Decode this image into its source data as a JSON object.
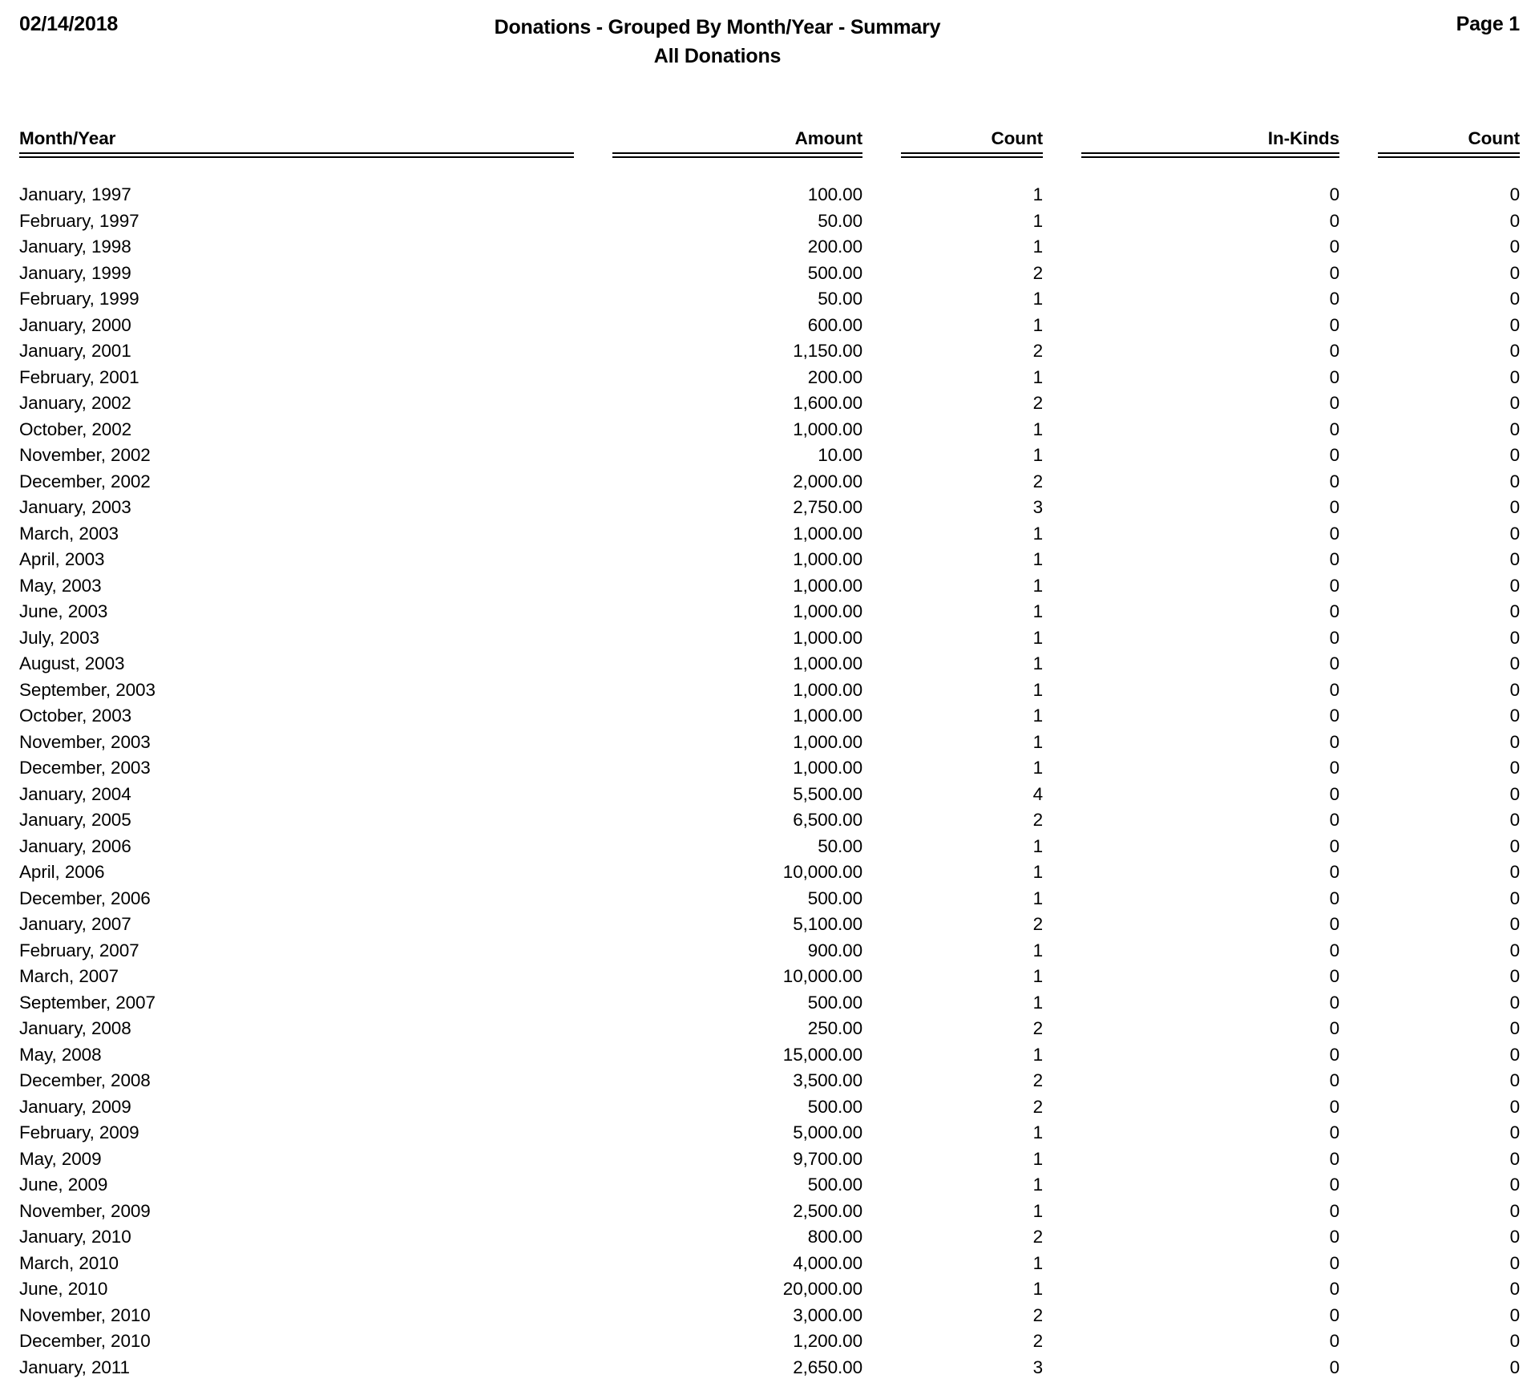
{
  "header": {
    "date": "02/14/2018",
    "title": "Donations - Grouped By Month/Year - Summary",
    "subtitle": "All Donations",
    "page_label": "Page 1"
  },
  "table": {
    "columns": [
      {
        "key": "month_year",
        "label": "Month/Year",
        "align": "left"
      },
      {
        "key": "amount",
        "label": "Amount",
        "align": "right"
      },
      {
        "key": "count",
        "label": "Count",
        "align": "right"
      },
      {
        "key": "in_kinds",
        "label": "In-Kinds",
        "align": "right"
      },
      {
        "key": "in_kinds_count",
        "label": "Count",
        "align": "right"
      }
    ],
    "rows": [
      {
        "month_year": "January, 1997",
        "amount": "100.00",
        "count": "1",
        "in_kinds": "0",
        "in_kinds_count": "0"
      },
      {
        "month_year": "February, 1997",
        "amount": "50.00",
        "count": "1",
        "in_kinds": "0",
        "in_kinds_count": "0"
      },
      {
        "month_year": "January, 1998",
        "amount": "200.00",
        "count": "1",
        "in_kinds": "0",
        "in_kinds_count": "0"
      },
      {
        "month_year": "January, 1999",
        "amount": "500.00",
        "count": "2",
        "in_kinds": "0",
        "in_kinds_count": "0"
      },
      {
        "month_year": "February, 1999",
        "amount": "50.00",
        "count": "1",
        "in_kinds": "0",
        "in_kinds_count": "0"
      },
      {
        "month_year": "January, 2000",
        "amount": "600.00",
        "count": "1",
        "in_kinds": "0",
        "in_kinds_count": "0"
      },
      {
        "month_year": "January, 2001",
        "amount": "1,150.00",
        "count": "2",
        "in_kinds": "0",
        "in_kinds_count": "0"
      },
      {
        "month_year": "February, 2001",
        "amount": "200.00",
        "count": "1",
        "in_kinds": "0",
        "in_kinds_count": "0"
      },
      {
        "month_year": "January, 2002",
        "amount": "1,600.00",
        "count": "2",
        "in_kinds": "0",
        "in_kinds_count": "0"
      },
      {
        "month_year": "October, 2002",
        "amount": "1,000.00",
        "count": "1",
        "in_kinds": "0",
        "in_kinds_count": "0"
      },
      {
        "month_year": "November, 2002",
        "amount": "10.00",
        "count": "1",
        "in_kinds": "0",
        "in_kinds_count": "0"
      },
      {
        "month_year": "December, 2002",
        "amount": "2,000.00",
        "count": "2",
        "in_kinds": "0",
        "in_kinds_count": "0"
      },
      {
        "month_year": "January, 2003",
        "amount": "2,750.00",
        "count": "3",
        "in_kinds": "0",
        "in_kinds_count": "0"
      },
      {
        "month_year": "March, 2003",
        "amount": "1,000.00",
        "count": "1",
        "in_kinds": "0",
        "in_kinds_count": "0"
      },
      {
        "month_year": "April, 2003",
        "amount": "1,000.00",
        "count": "1",
        "in_kinds": "0",
        "in_kinds_count": "0"
      },
      {
        "month_year": "May, 2003",
        "amount": "1,000.00",
        "count": "1",
        "in_kinds": "0",
        "in_kinds_count": "0"
      },
      {
        "month_year": "June, 2003",
        "amount": "1,000.00",
        "count": "1",
        "in_kinds": "0",
        "in_kinds_count": "0"
      },
      {
        "month_year": "July, 2003",
        "amount": "1,000.00",
        "count": "1",
        "in_kinds": "0",
        "in_kinds_count": "0"
      },
      {
        "month_year": "August, 2003",
        "amount": "1,000.00",
        "count": "1",
        "in_kinds": "0",
        "in_kinds_count": "0"
      },
      {
        "month_year": "September, 2003",
        "amount": "1,000.00",
        "count": "1",
        "in_kinds": "0",
        "in_kinds_count": "0"
      },
      {
        "month_year": "October, 2003",
        "amount": "1,000.00",
        "count": "1",
        "in_kinds": "0",
        "in_kinds_count": "0"
      },
      {
        "month_year": "November, 2003",
        "amount": "1,000.00",
        "count": "1",
        "in_kinds": "0",
        "in_kinds_count": "0"
      },
      {
        "month_year": "December, 2003",
        "amount": "1,000.00",
        "count": "1",
        "in_kinds": "0",
        "in_kinds_count": "0"
      },
      {
        "month_year": "January, 2004",
        "amount": "5,500.00",
        "count": "4",
        "in_kinds": "0",
        "in_kinds_count": "0"
      },
      {
        "month_year": "January, 2005",
        "amount": "6,500.00",
        "count": "2",
        "in_kinds": "0",
        "in_kinds_count": "0"
      },
      {
        "month_year": "January, 2006",
        "amount": "50.00",
        "count": "1",
        "in_kinds": "0",
        "in_kinds_count": "0"
      },
      {
        "month_year": "April, 2006",
        "amount": "10,000.00",
        "count": "1",
        "in_kinds": "0",
        "in_kinds_count": "0"
      },
      {
        "month_year": "December, 2006",
        "amount": "500.00",
        "count": "1",
        "in_kinds": "0",
        "in_kinds_count": "0"
      },
      {
        "month_year": "January, 2007",
        "amount": "5,100.00",
        "count": "2",
        "in_kinds": "0",
        "in_kinds_count": "0"
      },
      {
        "month_year": "February, 2007",
        "amount": "900.00",
        "count": "1",
        "in_kinds": "0",
        "in_kinds_count": "0"
      },
      {
        "month_year": "March, 2007",
        "amount": "10,000.00",
        "count": "1",
        "in_kinds": "0",
        "in_kinds_count": "0"
      },
      {
        "month_year": "September, 2007",
        "amount": "500.00",
        "count": "1",
        "in_kinds": "0",
        "in_kinds_count": "0"
      },
      {
        "month_year": "January, 2008",
        "amount": "250.00",
        "count": "2",
        "in_kinds": "0",
        "in_kinds_count": "0"
      },
      {
        "month_year": "May, 2008",
        "amount": "15,000.00",
        "count": "1",
        "in_kinds": "0",
        "in_kinds_count": "0"
      },
      {
        "month_year": "December, 2008",
        "amount": "3,500.00",
        "count": "2",
        "in_kinds": "0",
        "in_kinds_count": "0"
      },
      {
        "month_year": "January, 2009",
        "amount": "500.00",
        "count": "2",
        "in_kinds": "0",
        "in_kinds_count": "0"
      },
      {
        "month_year": "February, 2009",
        "amount": "5,000.00",
        "count": "1",
        "in_kinds": "0",
        "in_kinds_count": "0"
      },
      {
        "month_year": "May, 2009",
        "amount": "9,700.00",
        "count": "1",
        "in_kinds": "0",
        "in_kinds_count": "0"
      },
      {
        "month_year": "June, 2009",
        "amount": "500.00",
        "count": "1",
        "in_kinds": "0",
        "in_kinds_count": "0"
      },
      {
        "month_year": "November, 2009",
        "amount": "2,500.00",
        "count": "1",
        "in_kinds": "0",
        "in_kinds_count": "0"
      },
      {
        "month_year": "January, 2010",
        "amount": "800.00",
        "count": "2",
        "in_kinds": "0",
        "in_kinds_count": "0"
      },
      {
        "month_year": "March, 2010",
        "amount": "4,000.00",
        "count": "1",
        "in_kinds": "0",
        "in_kinds_count": "0"
      },
      {
        "month_year": "June, 2010",
        "amount": "20,000.00",
        "count": "1",
        "in_kinds": "0",
        "in_kinds_count": "0"
      },
      {
        "month_year": "November, 2010",
        "amount": "3,000.00",
        "count": "2",
        "in_kinds": "0",
        "in_kinds_count": "0"
      },
      {
        "month_year": "December, 2010",
        "amount": "1,200.00",
        "count": "2",
        "in_kinds": "0",
        "in_kinds_count": "0"
      },
      {
        "month_year": "January, 2011",
        "amount": "2,650.00",
        "count": "3",
        "in_kinds": "0",
        "in_kinds_count": "0"
      }
    ]
  }
}
